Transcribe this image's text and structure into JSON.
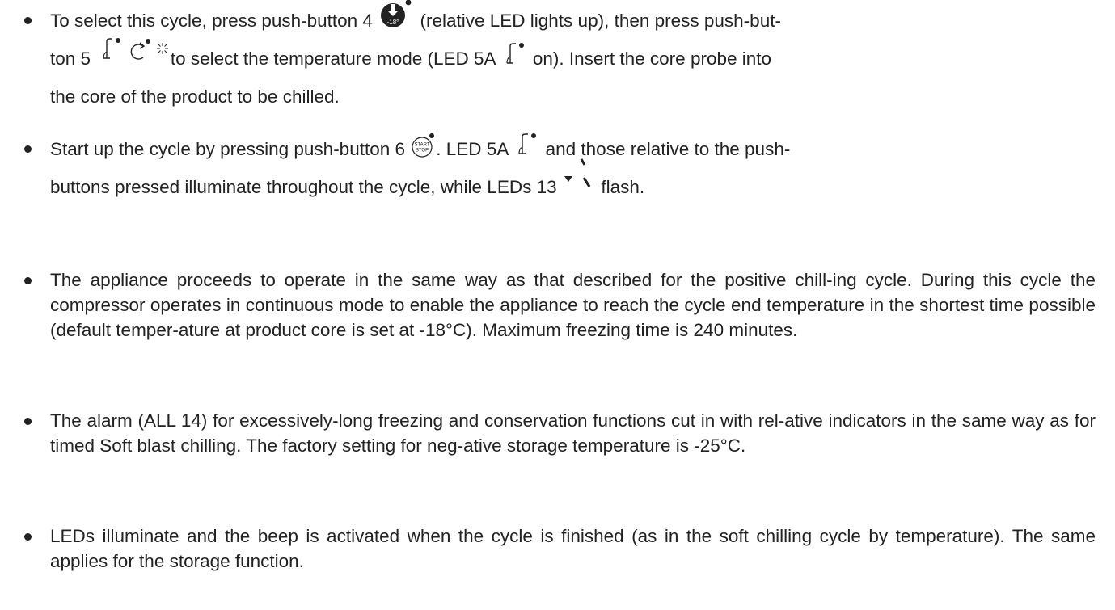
{
  "bullets": [
    {
      "line1_a": "To select this cycle, press push-button 4",
      "line1_b": "(relative LED lights up), then press push-but-",
      "line2_a": "ton 5",
      "line2_b": "to select the temperature mode (LED 5A",
      "line2_c": "on). Insert the core probe into",
      "line3": "the core of the product to be chilled."
    },
    {
      "line1_a": "Start up the cycle by pressing push-button 6",
      "line1_b": ". LED 5A",
      "line1_c": "and those relative to the push-",
      "line2_a": "buttons pressed illuminate throughout the cycle, while LEDs 13",
      "line2_b": "flash."
    },
    {
      "text": "The appliance proceeds to operate in the same way as that described for the positive chill-ing cycle. During this cycle the compressor operates in continuous mode to enable the appliance to reach the cycle end temperature in the shortest time possible (default temper-ature at product core is set at -18°C). Maximum freezing time is 240 minutes."
    },
    {
      "text": "The alarm (ALL 14) for excessively-long freezing and conservation functions cut in with rel-ative indicators in the same way as for timed Soft blast chilling. The factory setting for neg-ative storage temperature is -25°C."
    },
    {
      "text": "LEDs illuminate and the beep is activated when the cycle is finished (as in the soft chilling cycle by temperature). The same applies for the storage function."
    }
  ],
  "icons": {
    "minus18_label": "-18°",
    "start_label": "START",
    "stop_label": "STOP",
    "names": [
      "minus18-button-icon",
      "probe-icon",
      "cycle-arrow-icon",
      "snowflake-icon",
      "start-stop-icon",
      "down-arrow-icon",
      "slash-led-icon"
    ]
  }
}
